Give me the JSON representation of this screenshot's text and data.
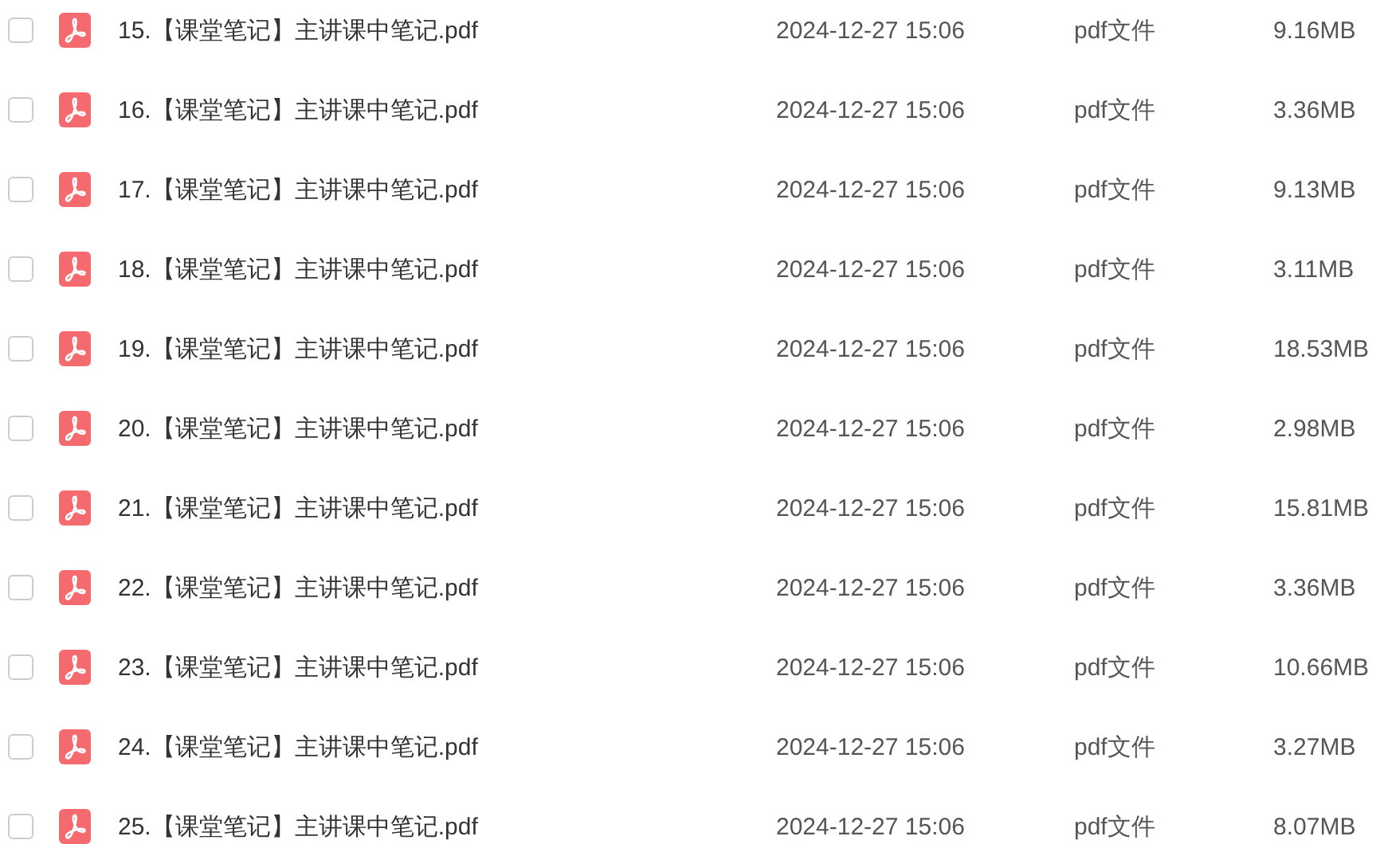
{
  "files": [
    {
      "name": "15.【课堂笔记】主讲课中笔记.pdf",
      "date": "2024-12-27 15:06",
      "type": "pdf文件",
      "size": "9.16MB",
      "checked": false
    },
    {
      "name": "16.【课堂笔记】主讲课中笔记.pdf",
      "date": "2024-12-27 15:06",
      "type": "pdf文件",
      "size": "3.36MB",
      "checked": false
    },
    {
      "name": "17.【课堂笔记】主讲课中笔记.pdf",
      "date": "2024-12-27 15:06",
      "type": "pdf文件",
      "size": "9.13MB",
      "checked": false
    },
    {
      "name": "18.【课堂笔记】主讲课中笔记.pdf",
      "date": "2024-12-27 15:06",
      "type": "pdf文件",
      "size": "3.11MB",
      "checked": false
    },
    {
      "name": "19.【课堂笔记】主讲课中笔记.pdf",
      "date": "2024-12-27 15:06",
      "type": "pdf文件",
      "size": "18.53MB",
      "checked": false
    },
    {
      "name": "20.【课堂笔记】主讲课中笔记.pdf",
      "date": "2024-12-27 15:06",
      "type": "pdf文件",
      "size": "2.98MB",
      "checked": false
    },
    {
      "name": "21.【课堂笔记】主讲课中笔记.pdf",
      "date": "2024-12-27 15:06",
      "type": "pdf文件",
      "size": "15.81MB",
      "checked": false
    },
    {
      "name": "22.【课堂笔记】主讲课中笔记.pdf",
      "date": "2024-12-27 15:06",
      "type": "pdf文件",
      "size": "3.36MB",
      "checked": false
    },
    {
      "name": "23.【课堂笔记】主讲课中笔记.pdf",
      "date": "2024-12-27 15:06",
      "type": "pdf文件",
      "size": "10.66MB",
      "checked": false
    },
    {
      "name": "24.【课堂笔记】主讲课中笔记.pdf",
      "date": "2024-12-27 15:06",
      "type": "pdf文件",
      "size": "3.27MB",
      "checked": false
    },
    {
      "name": "25.【课堂笔记】主讲课中笔记.pdf",
      "date": "2024-12-27 15:06",
      "type": "pdf文件",
      "size": "8.07MB",
      "checked": false
    }
  ]
}
